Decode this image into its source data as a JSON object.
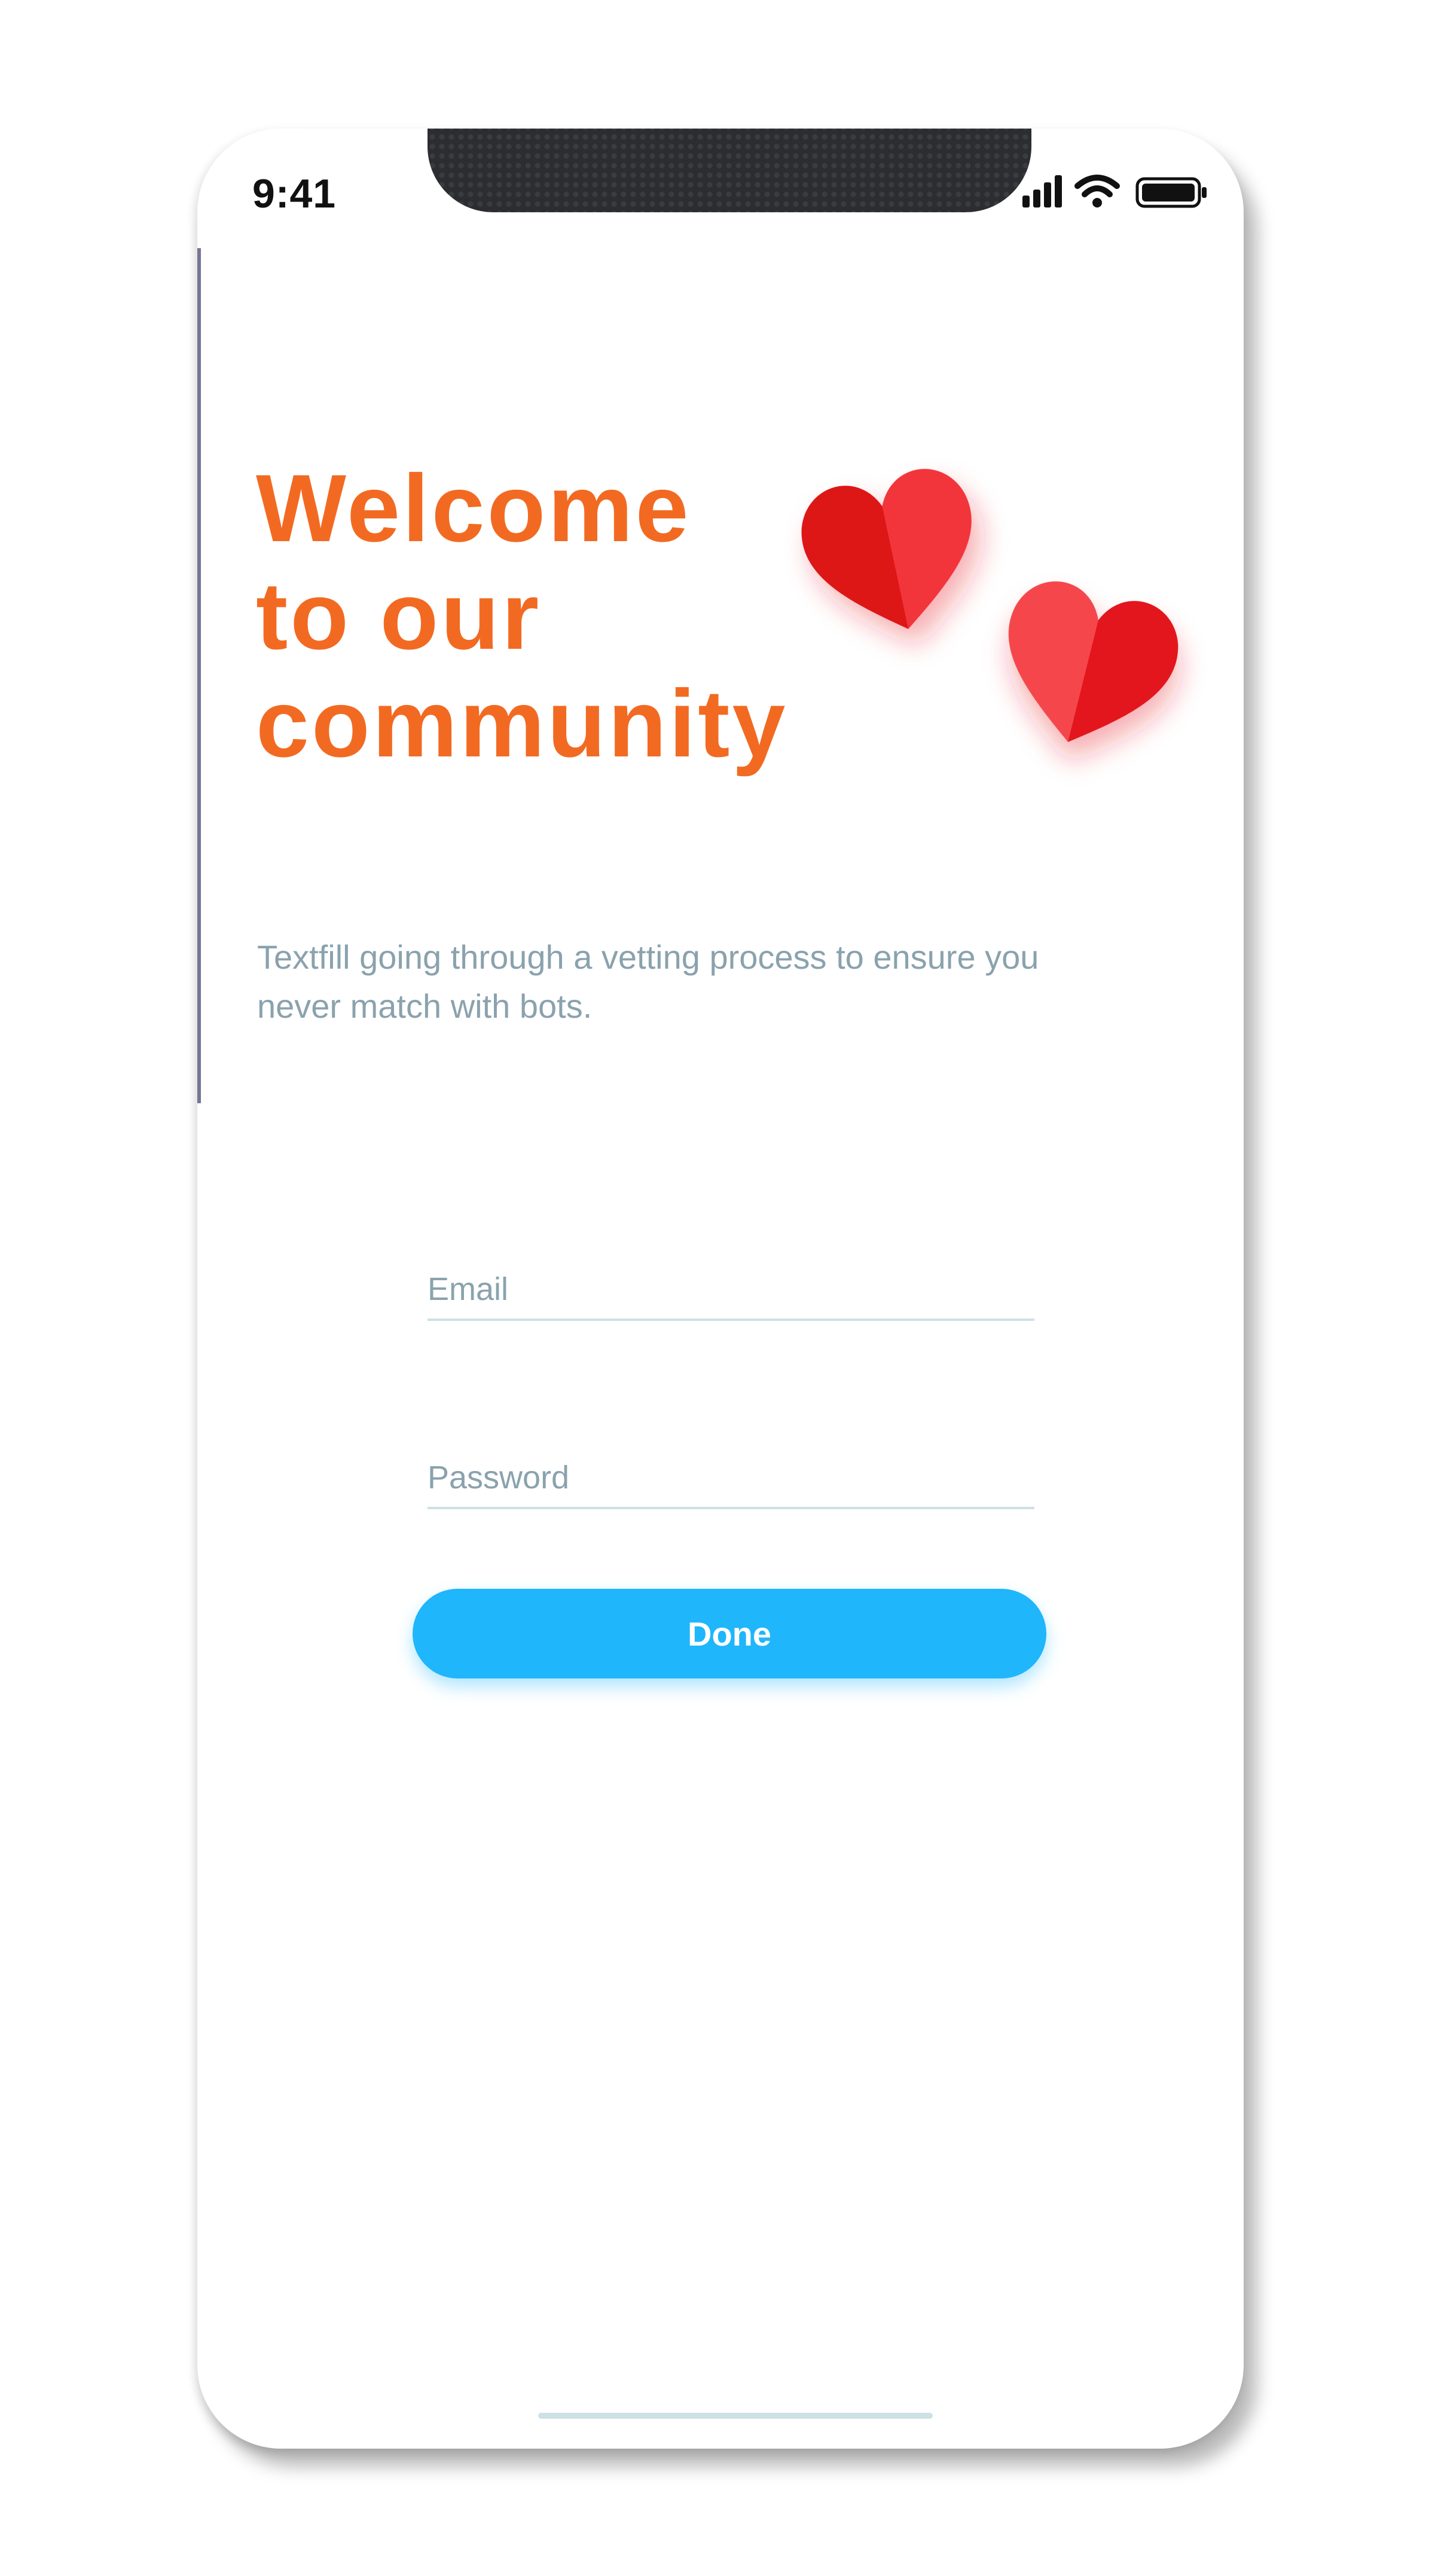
{
  "status_bar": {
    "time": "9:41",
    "icons": [
      "signal-icon",
      "wifi-icon",
      "battery-icon"
    ]
  },
  "welcome": {
    "title_line_1": "Welcome",
    "title_line_2": "to our",
    "title_line_3": "community",
    "subtitle_line_1": "Textfill going through a vetting process to ensure you",
    "subtitle_line_2": "never match with bots.",
    "decoration": "hearts-icon"
  },
  "form": {
    "email_placeholder": "Email",
    "email_value": "",
    "password_placeholder": "Password",
    "password_value": "",
    "submit_label": "Done"
  },
  "colors": {
    "accent_orange": "#f26a22",
    "button_blue": "#1fb6fb",
    "muted_text": "#8aa2ad",
    "heart_red": "#e8202a"
  }
}
